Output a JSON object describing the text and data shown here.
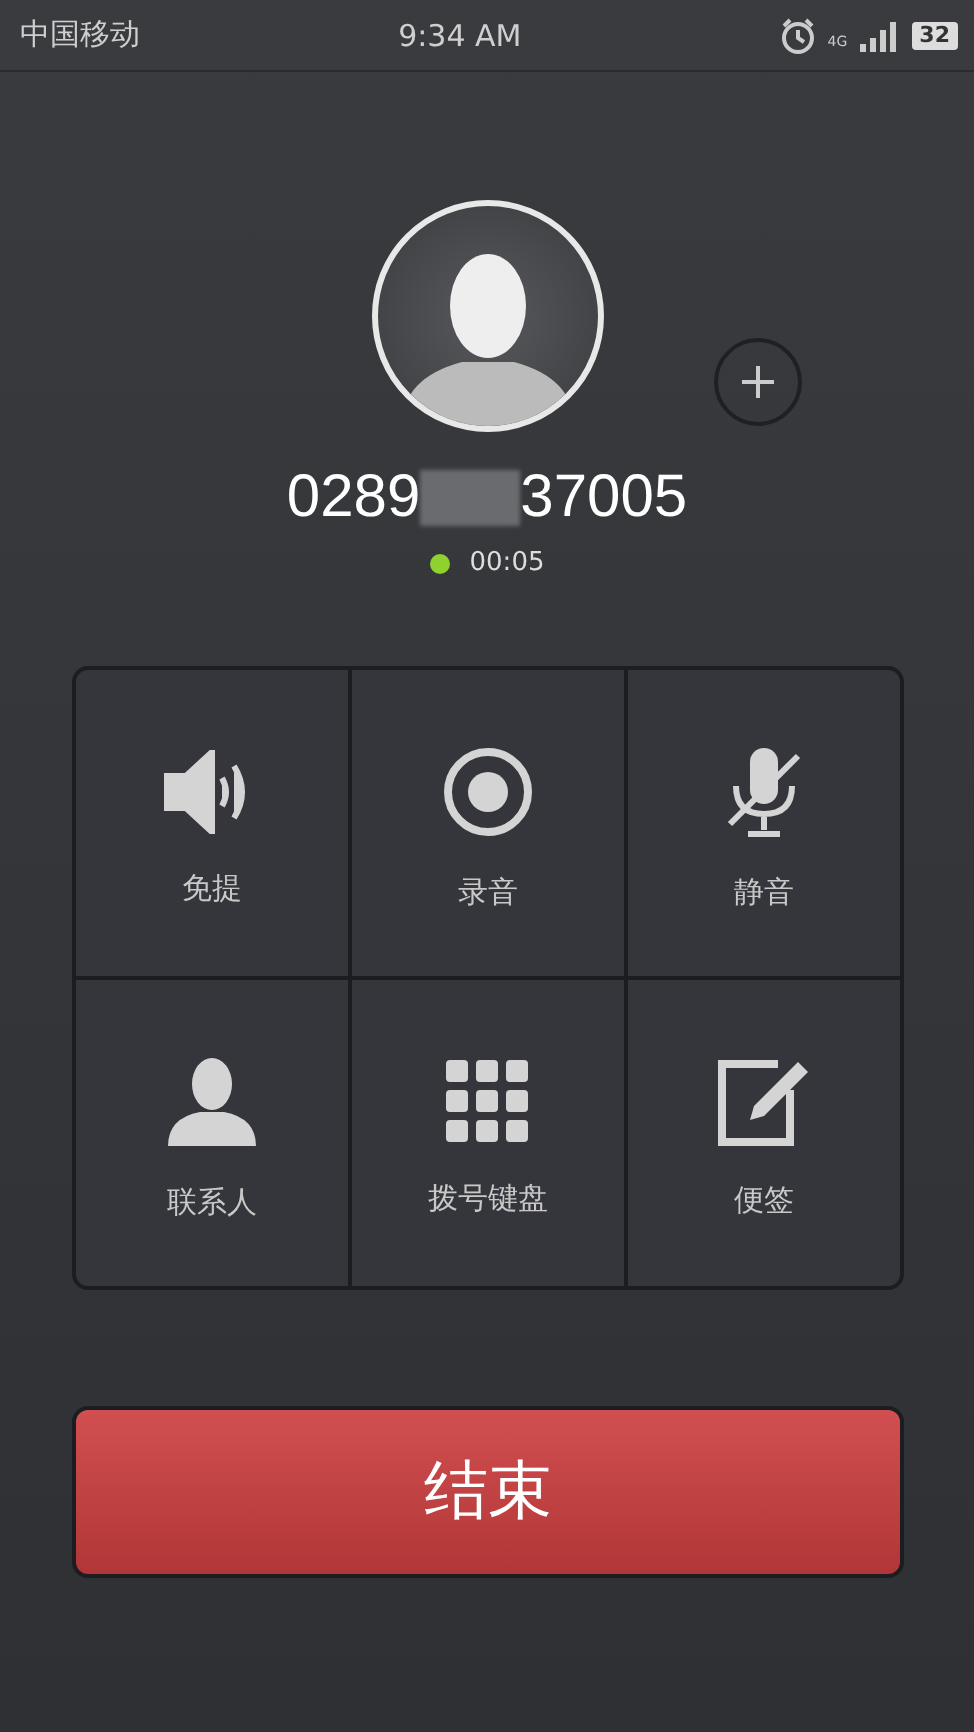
{
  "status_bar": {
    "carrier": "中国移动",
    "time": "9:34 AM",
    "network": "4G",
    "battery": "32"
  },
  "caller": {
    "number_start": "0289",
    "number_end": "37005",
    "number_masked": true,
    "duration": "00:05",
    "connected": true
  },
  "actions": [
    {
      "kind": "speaker",
      "label": "免提"
    },
    {
      "kind": "record",
      "label": "录音"
    },
    {
      "kind": "mute",
      "label": "静音"
    },
    {
      "kind": "contacts",
      "label": "联系人"
    },
    {
      "kind": "keypad",
      "label": "拨号键盘"
    },
    {
      "kind": "note",
      "label": "便签"
    }
  ],
  "end_button": {
    "label": "结束"
  }
}
